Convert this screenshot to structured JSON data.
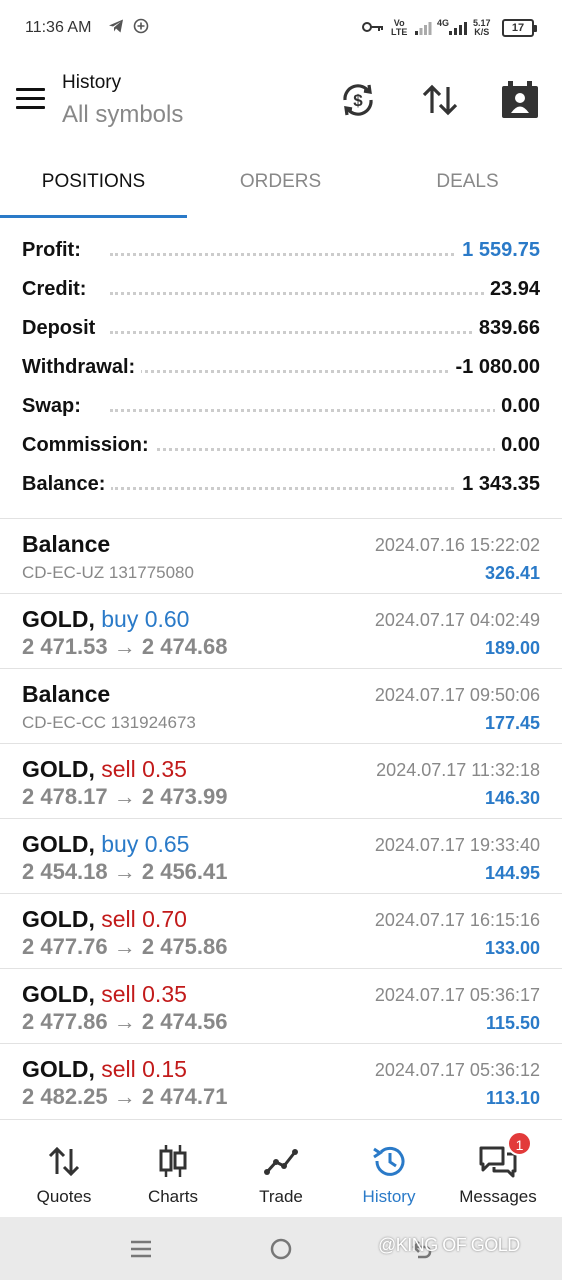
{
  "status_bar": {
    "time": "11:36 AM",
    "volte_top": "Vo",
    "volte_bottom": "LTE",
    "network": "4G",
    "speed_top": "5.17",
    "speed_bottom": "K/S",
    "battery": "17"
  },
  "header": {
    "title": "History",
    "subtitle": "All symbols"
  },
  "tabs": [
    {
      "label": "POSITIONS",
      "active": true
    },
    {
      "label": "ORDERS",
      "active": false
    },
    {
      "label": "DEALS",
      "active": false
    }
  ],
  "summary": [
    {
      "label": "Profit:",
      "value": "1 559.75",
      "highlight": true
    },
    {
      "label": "Credit:",
      "value": "23.94"
    },
    {
      "label": "Deposit",
      "value": "839.66"
    },
    {
      "label": "Withdrawal:",
      "value": "-1 080.00"
    },
    {
      "label": "Swap:",
      "value": "0.00"
    },
    {
      "label": "Commission:",
      "value": "0.00"
    },
    {
      "label": "Balance:",
      "value": "1 343.35"
    }
  ],
  "deals": [
    {
      "title": "Balance",
      "sub": "CD-EC-UZ 131775080",
      "time": "2024.07.16 15:22:02",
      "profit": "326.41"
    },
    {
      "symbol": "GOLD,",
      "side": "buy",
      "volume": "buy 0.60",
      "prices": "2 471.53 → 2 474.68",
      "time": "2024.07.17 04:02:49",
      "profit": "189.00"
    },
    {
      "title": "Balance",
      "sub": "CD-EC-CC 131924673",
      "time": "2024.07.17 09:50:06",
      "profit": "177.45"
    },
    {
      "symbol": "GOLD,",
      "side": "sell",
      "volume": "sell 0.35",
      "prices": "2 478.17 → 2 473.99",
      "time": "2024.07.17 11:32:18",
      "profit": "146.30"
    },
    {
      "symbol": "GOLD,",
      "side": "buy",
      "volume": "buy 0.65",
      "prices": "2 454.18 → 2 456.41",
      "time": "2024.07.17 19:33:40",
      "profit": "144.95"
    },
    {
      "symbol": "GOLD,",
      "side": "sell",
      "volume": "sell 0.70",
      "prices": "2 477.76 → 2 475.86",
      "time": "2024.07.17 16:15:16",
      "profit": "133.00"
    },
    {
      "symbol": "GOLD,",
      "side": "sell",
      "volume": "sell 0.35",
      "prices": "2 477.86 → 2 474.56",
      "time": "2024.07.17 05:36:17",
      "profit": "115.50"
    },
    {
      "symbol": "GOLD,",
      "side": "sell",
      "volume": "sell 0.15",
      "prices": "2 482.25 → 2 474.71",
      "time": "2024.07.17 05:36:12",
      "profit": "113.10"
    }
  ],
  "bottom_nav": [
    {
      "label": "Quotes",
      "icon": "quotes-arrows-icon"
    },
    {
      "label": "Charts",
      "icon": "candlestick-icon"
    },
    {
      "label": "Trade",
      "icon": "trend-line-icon"
    },
    {
      "label": "History",
      "icon": "history-clock-icon",
      "active": true
    },
    {
      "label": "Messages",
      "icon": "chat-bubbles-icon",
      "badge": "1"
    }
  ],
  "watermark": "@KING OF GOLD",
  "colors": {
    "accent": "#2a7ac8",
    "sell": "#c21a1a",
    "muted": "#888888",
    "badge": "#e23a3a"
  }
}
